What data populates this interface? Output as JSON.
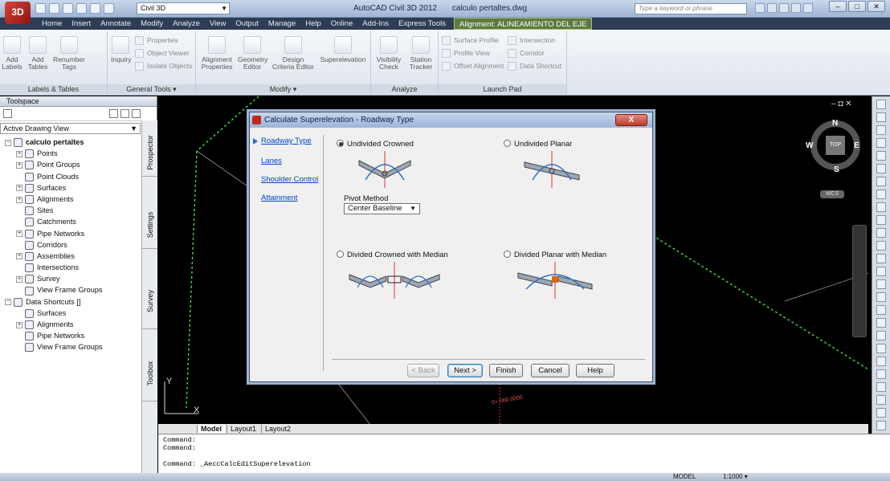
{
  "app": {
    "logo_text": "3D",
    "workspace": "Civil 3D",
    "product": "AutoCAD Civil 3D 2012",
    "file": "calculo pertaltes.dwg",
    "search_placeholder": "Type a keyword or phrase"
  },
  "ribbon_tabs": [
    "Home",
    "Insert",
    "Annotate",
    "Modify",
    "Analyze",
    "View",
    "Output",
    "Manage",
    "Help",
    "Online",
    "Add-Ins",
    "Express Tools",
    "Alignment: ALINEAMIENTO DEL EJE"
  ],
  "ribbon": {
    "labels_tables": {
      "title": "Labels & Tables",
      "add_labels": "Add\nLabels",
      "add_tables": "Add\nTables",
      "renumber_tags": "Renumber\nTags"
    },
    "general_tools": {
      "title": "General Tools ▾",
      "inquiry": "Inquiry",
      "properties": "Properties",
      "object_viewer": "Object Viewer",
      "isolate_objects": "Isolate Objects"
    },
    "modify": {
      "title": "Modify ▾",
      "alignment_properties": "Alignment\nProperties",
      "geometry_editor": "Geometry\nEditor",
      "design_criteria_editor": "Design\nCriteria Editor",
      "superelevation": "Superelevation"
    },
    "analyze": {
      "title": "Analyze",
      "visibility_check": "Visibility\nCheck",
      "station_tracker": "Station\nTracker"
    },
    "launch_pad": {
      "title": "Launch Pad",
      "surface_profile": "Surface Profile",
      "profile_view": "Profile View",
      "offset_alignment": "Offset Alignment",
      "intersection": "Intersection",
      "corridor": "Corridor",
      "data_shortcut": "Data Shortcut"
    }
  },
  "toolspace": {
    "title": "Toolspace",
    "view": "Active Drawing View",
    "tree": [
      {
        "label": "calculo pertaltes",
        "level": 0,
        "toggle": "⊟",
        "bold": true
      },
      {
        "label": "Points",
        "level": 1,
        "toggle": "⊞"
      },
      {
        "label": "Point Groups",
        "level": 1,
        "toggle": "⊞"
      },
      {
        "label": "Point Clouds",
        "level": 1,
        "toggle": ""
      },
      {
        "label": "Surfaces",
        "level": 1,
        "toggle": "⊞"
      },
      {
        "label": "Alignments",
        "level": 1,
        "toggle": "⊞"
      },
      {
        "label": "Sites",
        "level": 1,
        "toggle": ""
      },
      {
        "label": "Catchments",
        "level": 1,
        "toggle": ""
      },
      {
        "label": "Pipe Networks",
        "level": 1,
        "toggle": "⊞"
      },
      {
        "label": "Corridors",
        "level": 1,
        "toggle": ""
      },
      {
        "label": "Assemblies",
        "level": 1,
        "toggle": "⊞"
      },
      {
        "label": "Intersections",
        "level": 1,
        "toggle": ""
      },
      {
        "label": "Survey",
        "level": 1,
        "toggle": "⊞"
      },
      {
        "label": "View Frame Groups",
        "level": 1,
        "toggle": ""
      },
      {
        "label": "Data Shortcuts []",
        "level": 0,
        "toggle": "⊟"
      },
      {
        "label": "Surfaces",
        "level": 1,
        "toggle": ""
      },
      {
        "label": "Alignments",
        "level": 1,
        "toggle": "⊞"
      },
      {
        "label": "Pipe Networks",
        "level": 1,
        "toggle": ""
      },
      {
        "label": "View Frame Groups",
        "level": 1,
        "toggle": ""
      }
    ],
    "vtabs": [
      "Prospector",
      "Settings",
      "Survey",
      "Toolbox"
    ]
  },
  "viewcube": {
    "n": "N",
    "s": "S",
    "e": "E",
    "w": "W",
    "top": "TOP",
    "wcs": "WCS"
  },
  "layout_tabs": [
    "Model",
    "Layout1",
    "Layout2"
  ],
  "command_lines": [
    "Command:",
    "Command:",
    "",
    "Command: _AeccCalcEditSuperelevation"
  ],
  "statusbar": {
    "scale": "1:1000 ▾",
    "model": "MODEL"
  },
  "canvas_label": "0+ 060.0000",
  "dialog": {
    "title": "Calculate Superelevation - Roadway Type",
    "close": "X",
    "nav": [
      "Roadway Type",
      "Lanes",
      "Shoulder Control",
      "Attainment"
    ],
    "options": [
      "Undivided Crowned",
      "Undivided Planar",
      "Divided Crowned with Median",
      "Divided Planar with Median"
    ],
    "selected_option": "Undivided Crowned",
    "pivot_label": "Pivot Method",
    "pivot_value": "Center Baseline",
    "buttons": {
      "back": "< Back",
      "next": "Next >",
      "finish": "Finish",
      "cancel": "Cancel",
      "help": "Help"
    }
  },
  "colors": {
    "accent_green": "#7bd842",
    "ribbon_ctx": "#5d7a3f",
    "dialog_border": "#3d4d64",
    "link": "#0044cc"
  }
}
